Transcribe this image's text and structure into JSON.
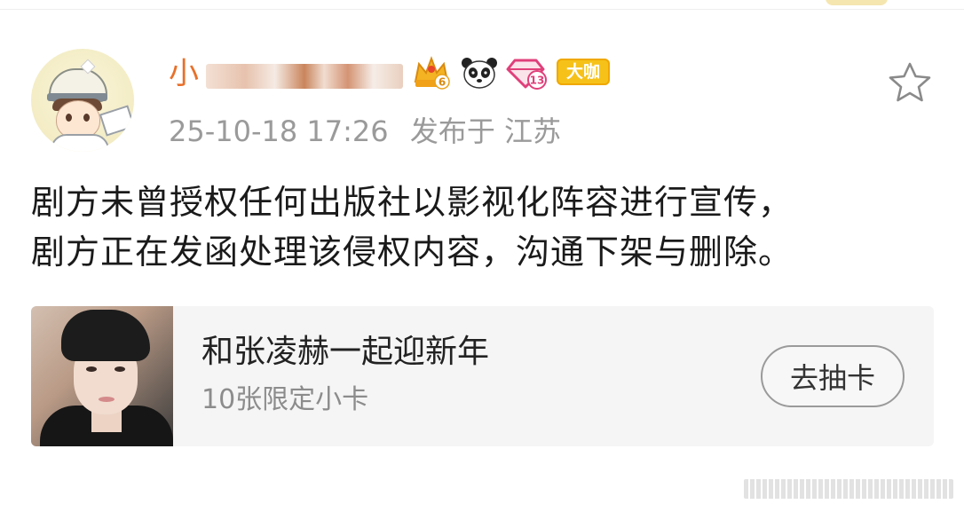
{
  "post": {
    "username_prefix": "小",
    "timestamp": "25-10-18 17:26",
    "location_text": "发布于 江苏",
    "badges": {
      "crown_level": "6",
      "diamond_level": "13",
      "daka_label": "大咖"
    },
    "body_lines": [
      "剧方未曾授权任何出版社以影视化阵容进行宣传，",
      "剧方正在发函处理该侵权内容，沟通下架与删除。"
    ]
  },
  "card": {
    "title": "和张凌赫一起迎新年",
    "subtitle": "10张限定小卡",
    "button_label": "去抽卡"
  },
  "colors": {
    "username": "#e8702a",
    "muted": "#9a9a9a",
    "badge_gold": "#f6c21a"
  },
  "icons": {
    "favorite": "star-outline-icon",
    "crown": "crown-badge-icon",
    "panda": "panda-badge-icon",
    "diamond": "diamond-badge-icon"
  }
}
